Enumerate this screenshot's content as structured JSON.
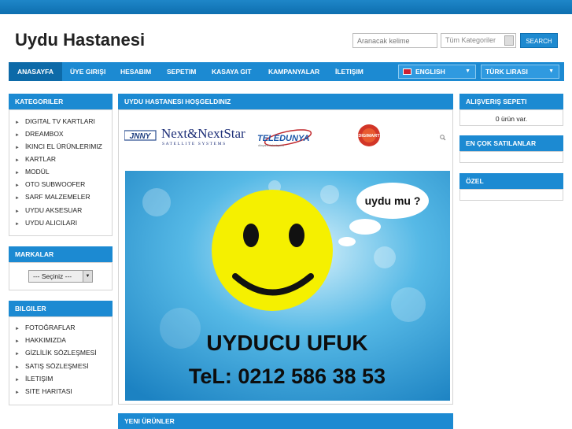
{
  "header": {
    "site_title": "Uydu Hastanesi",
    "search_placeholder": "Aranacak kelime",
    "category_select": "Tüm Kategoriler",
    "search_button": "SEARCH"
  },
  "nav": {
    "items": [
      "ANASAYFA",
      "ÜYE GIRIŞI",
      "HESABIM",
      "SEPETIM",
      "KASAYA GIT",
      "KAMPANYALAR",
      "İLETIŞIM"
    ],
    "language": "ENGLISH",
    "currency": "TÜRK LIRASI"
  },
  "sidebar": {
    "categories_title": "KATEGORILER",
    "categories": [
      "DIGITAL TV KARTLARI",
      "DREAMBOX",
      "İKINCI EL ÜRÜNLERIMIZ",
      "KARTLAR",
      "MODÜL",
      "OTO SUBWOOFER",
      "SARF MALZEMELER",
      "UYDU AKSESUAR",
      "UYDU ALICILARI"
    ],
    "brands_title": "MARKALAR",
    "brands_select": "--- Seçiniz ---",
    "info_title": "BILGILER",
    "info": [
      "FOTOĞRAFLAR",
      "HAKKIMIZDA",
      "GİZLİLİK SÖZLEŞMESİ",
      "SATIŞ SÖZLEŞMESİ",
      "İLETIŞIM",
      "SITE HARITASI"
    ]
  },
  "main": {
    "welcome_title": "UYDU HASTANESI HOŞGELDINIZ",
    "logos": {
      "jnny": "JNNY",
      "nextstar": "Next&NextStar",
      "nextstar_sub": "SATELLITE SYSTEMS",
      "teledunya": "TELEDUNYA",
      "teledunya_sub": "dünyanın televizyonu",
      "digimart": "DIGIMART"
    },
    "banner": {
      "bubble": "uydu mu ?",
      "name": "UYDUCU UFUK",
      "phone": "TeL: 0212 586 38 53"
    },
    "new_products_title": "YENI ÜRÜNLER"
  },
  "right": {
    "cart_title": "ALIŞVERIŞ SEPETI",
    "cart_text": "0 ürün var.",
    "bestsellers_title": "EN ÇOK SATILANLAR",
    "special_title": "ÖZEL"
  },
  "colors": {
    "accent": "#1c8ad2",
    "top_band": "#1e86c8",
    "smiley": "#f5f000"
  }
}
